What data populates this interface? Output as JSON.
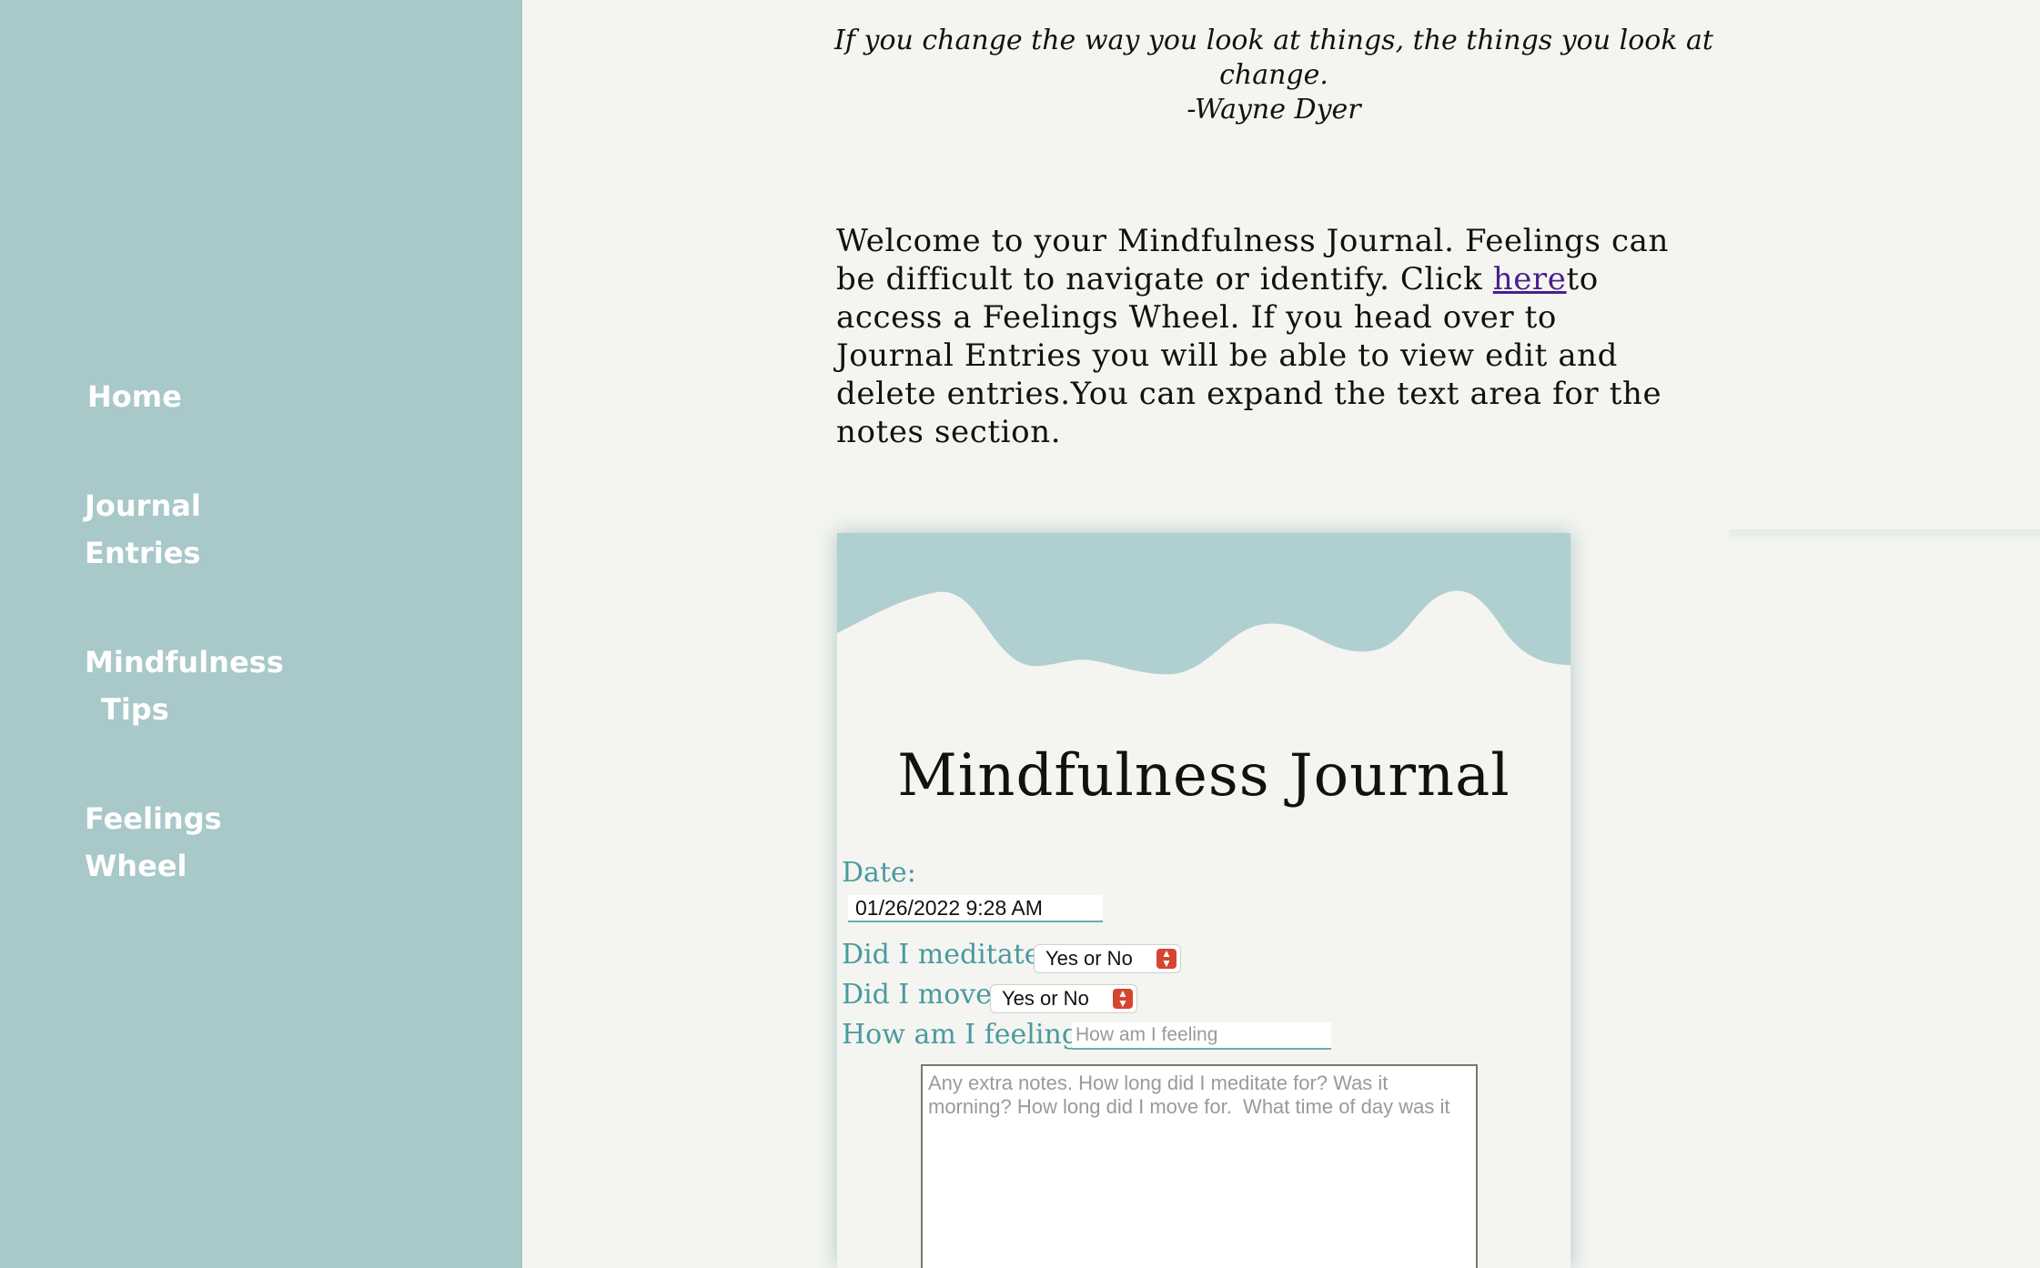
{
  "sidebar": {
    "home": "Home",
    "journal": [
      "Journal",
      "Entries"
    ],
    "tips": [
      "Mindfulness",
      "Tips"
    ],
    "wheel": [
      "Feelings",
      "Wheel"
    ]
  },
  "quote": {
    "line1": "If you change the way you look at things, the things you look at",
    "line2": "change.",
    "author": "-Wayne Dyer"
  },
  "welcome": {
    "before": "Welcome to your Mindfulness Journal. Feelings can be difficult to navigate or identify. Click ",
    "link": "here",
    "after": "to access a Feelings Wheel. If you head over to Journal Entries you will be able to view edit and delete entries.You can expand the text area for the notes section."
  },
  "card": {
    "title": "Mindfulness Journal",
    "date_label": "Date:",
    "date_value": "01/26/2022 9:28 AM",
    "meditate_label": "Did I meditate:",
    "meditate_value": "Yes or No",
    "move_label": "Did I move:",
    "move_value": "Yes or No",
    "feeling_label": "How am I feeling :",
    "feeling_placeholder": "How am I feeling",
    "notes_placeholder": "Any extra notes. How long did I meditate for? Was it morning? How long did I move for.  What time of day was it"
  },
  "colors": {
    "sidebar": "#a8c8c9",
    "background": "#f4f5f1",
    "label": "#4a9aa0",
    "link": "#4b1f8e",
    "select_arrow": "#d64530"
  },
  "icons": {
    "select_arrow": "chevron-up-down-icon"
  }
}
